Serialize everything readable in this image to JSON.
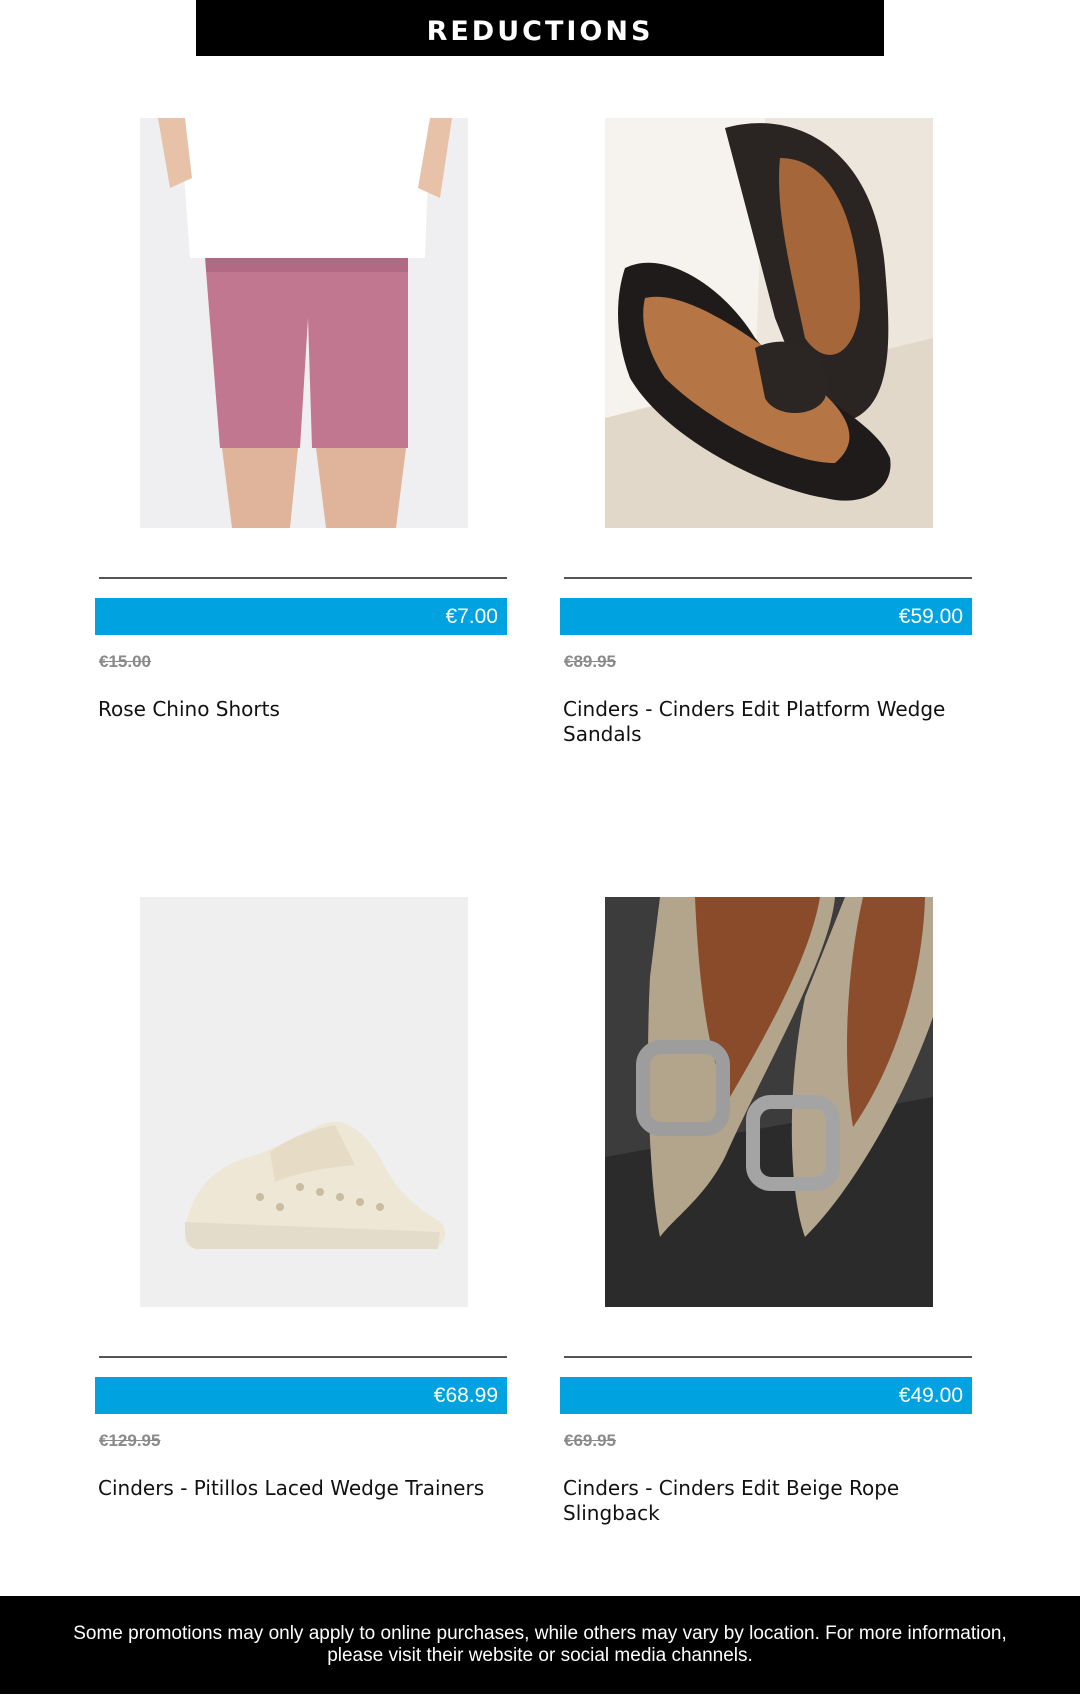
{
  "banner": {
    "title": "REDUCTIONS"
  },
  "products": [
    {
      "name": "Rose Chino Shorts",
      "price": "€7.00",
      "old_price": "€15.00",
      "image": "rose-chino-shorts-photo"
    },
    {
      "name": "Cinders - Cinders Edit Platform Wedge Sandals",
      "price": "€59.00",
      "old_price": "€89.95",
      "image": "platform-wedge-sandals-photo"
    },
    {
      "name": "Cinders - Pitillos Laced Wedge Trainers",
      "price": "€68.99",
      "old_price": "€129.95",
      "image": "laced-wedge-trainers-photo"
    },
    {
      "name": "Cinders - Cinders Edit Beige Rope Slingback",
      "price": "€49.00",
      "old_price": "€69.95",
      "image": "rope-slingback-photo"
    }
  ],
  "footer": {
    "text": "Some promotions may only apply to online purchases, while others may vary by location. For more information, please visit their website or social media channels."
  },
  "colors": {
    "price_bar": "#00a3e0",
    "banner": "#000000",
    "old_price": "#8a8a8a"
  }
}
